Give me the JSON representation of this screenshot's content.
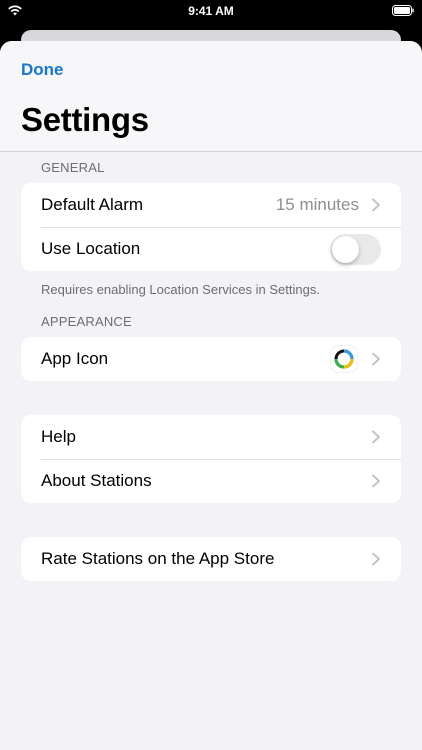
{
  "status_bar": {
    "time": "9:41 AM",
    "wifi_icon": "wifi-icon",
    "battery_icon": "battery-icon"
  },
  "navbar": {
    "done_label": "Done",
    "title": "Settings",
    "accent_color": "#1478D4"
  },
  "sections": {
    "general": {
      "header": "GENERAL",
      "default_alarm": {
        "label": "Default Alarm",
        "value": "15 minutes"
      },
      "use_location": {
        "label": "Use Location",
        "toggle_on": false
      },
      "footer": "Requires enabling Location Services in Settings."
    },
    "appearance": {
      "header": "APPEARANCE",
      "app_icon": {
        "label": "App Icon",
        "icon": "app-icon-ring"
      }
    },
    "support": {
      "help": {
        "label": "Help"
      },
      "about": {
        "label": "About Stations"
      }
    },
    "rate": {
      "rate": {
        "label": "Rate Stations on the App Store"
      }
    }
  }
}
